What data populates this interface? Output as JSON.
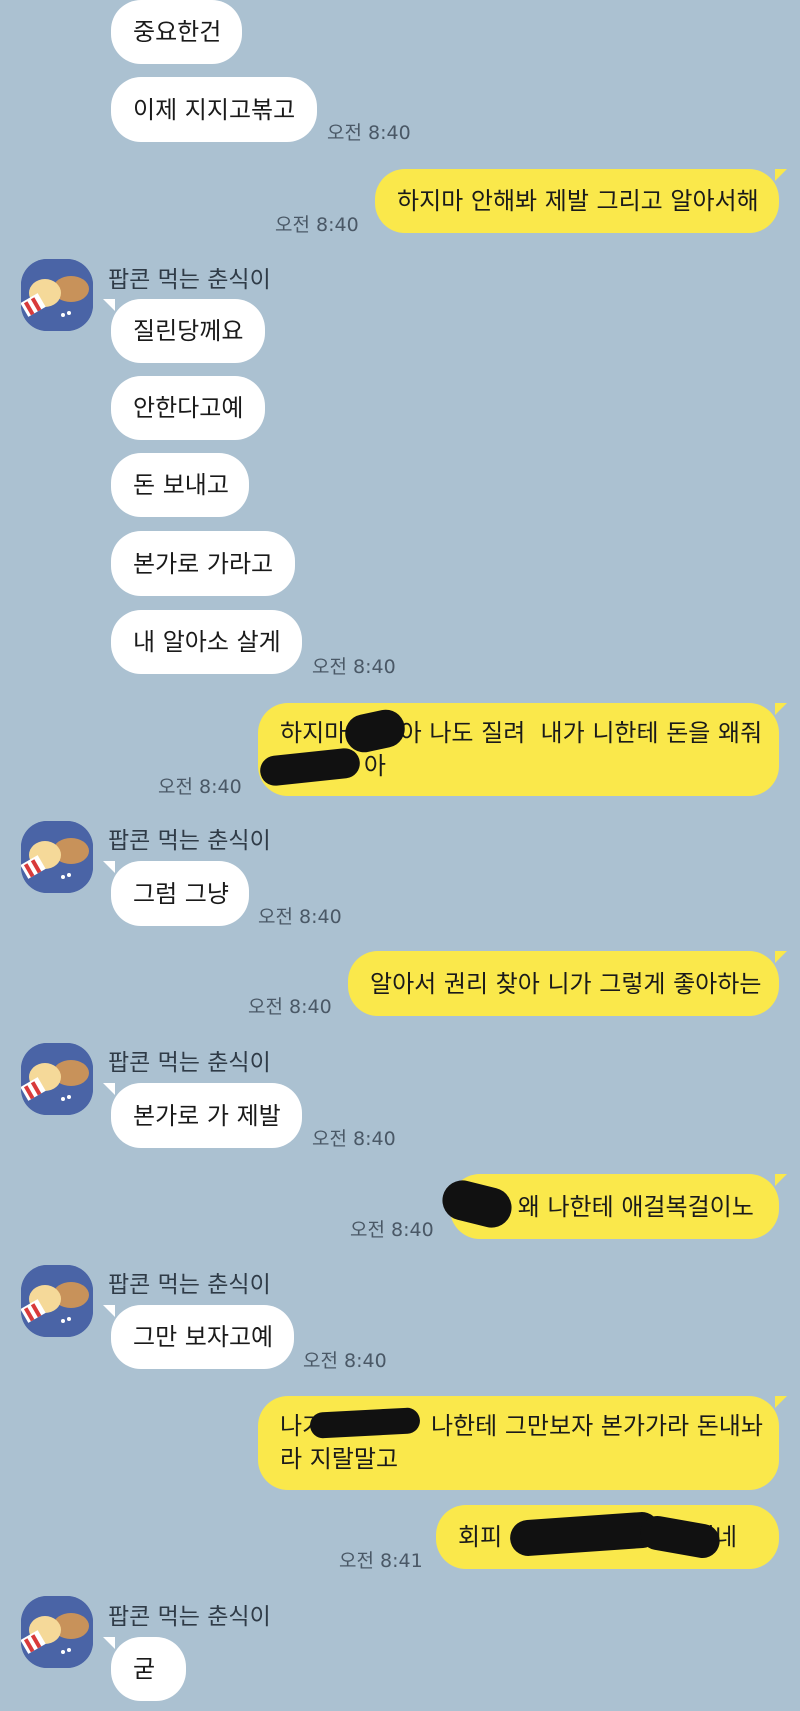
{
  "chat": {
    "sender_name": "팝콘 먹는 춘식이",
    "messages": [
      {
        "text": "중요한건"
      },
      {
        "text": "이제 지지고볶고",
        "time": "오전 8:40"
      },
      {
        "text": "하지마 안해봐 제발 그리고 알아서해",
        "time": "오전 8:40"
      },
      {
        "text": "질린당께요"
      },
      {
        "text": "안한다고예"
      },
      {
        "text": "돈 보내고"
      },
      {
        "text": "본가로 가라고"
      },
      {
        "text": "내 알아소 살게",
        "time": "오전 8:40"
      },
      {
        "line1": "하지마       아 나도 질려  내가 니한테 돈을 왜줘",
        "line2": "           아",
        "time": "오전 8:40"
      },
      {
        "text": "그럼 그냥",
        "time": "오전 8:40"
      },
      {
        "text": "알아서 권리 찾아 니가 그렇게 좋아하는",
        "time": "오전 8:40"
      },
      {
        "text": "본가로 가 제발",
        "time": "오전 8:40"
      },
      {
        "text": "      왜 나한테 애걸복걸이노",
        "time": "오전 8:40"
      },
      {
        "text": "그만 보자고예",
        "time": "오전 8:40"
      },
      {
        "line1": "나가              나한테 그만보자 본가가라 돈내놔",
        "line2": "라 지랄말고"
      },
      {
        "text": "회피                         이네",
        "time": "오전 8:41"
      },
      {
        "text": "굳"
      }
    ]
  }
}
